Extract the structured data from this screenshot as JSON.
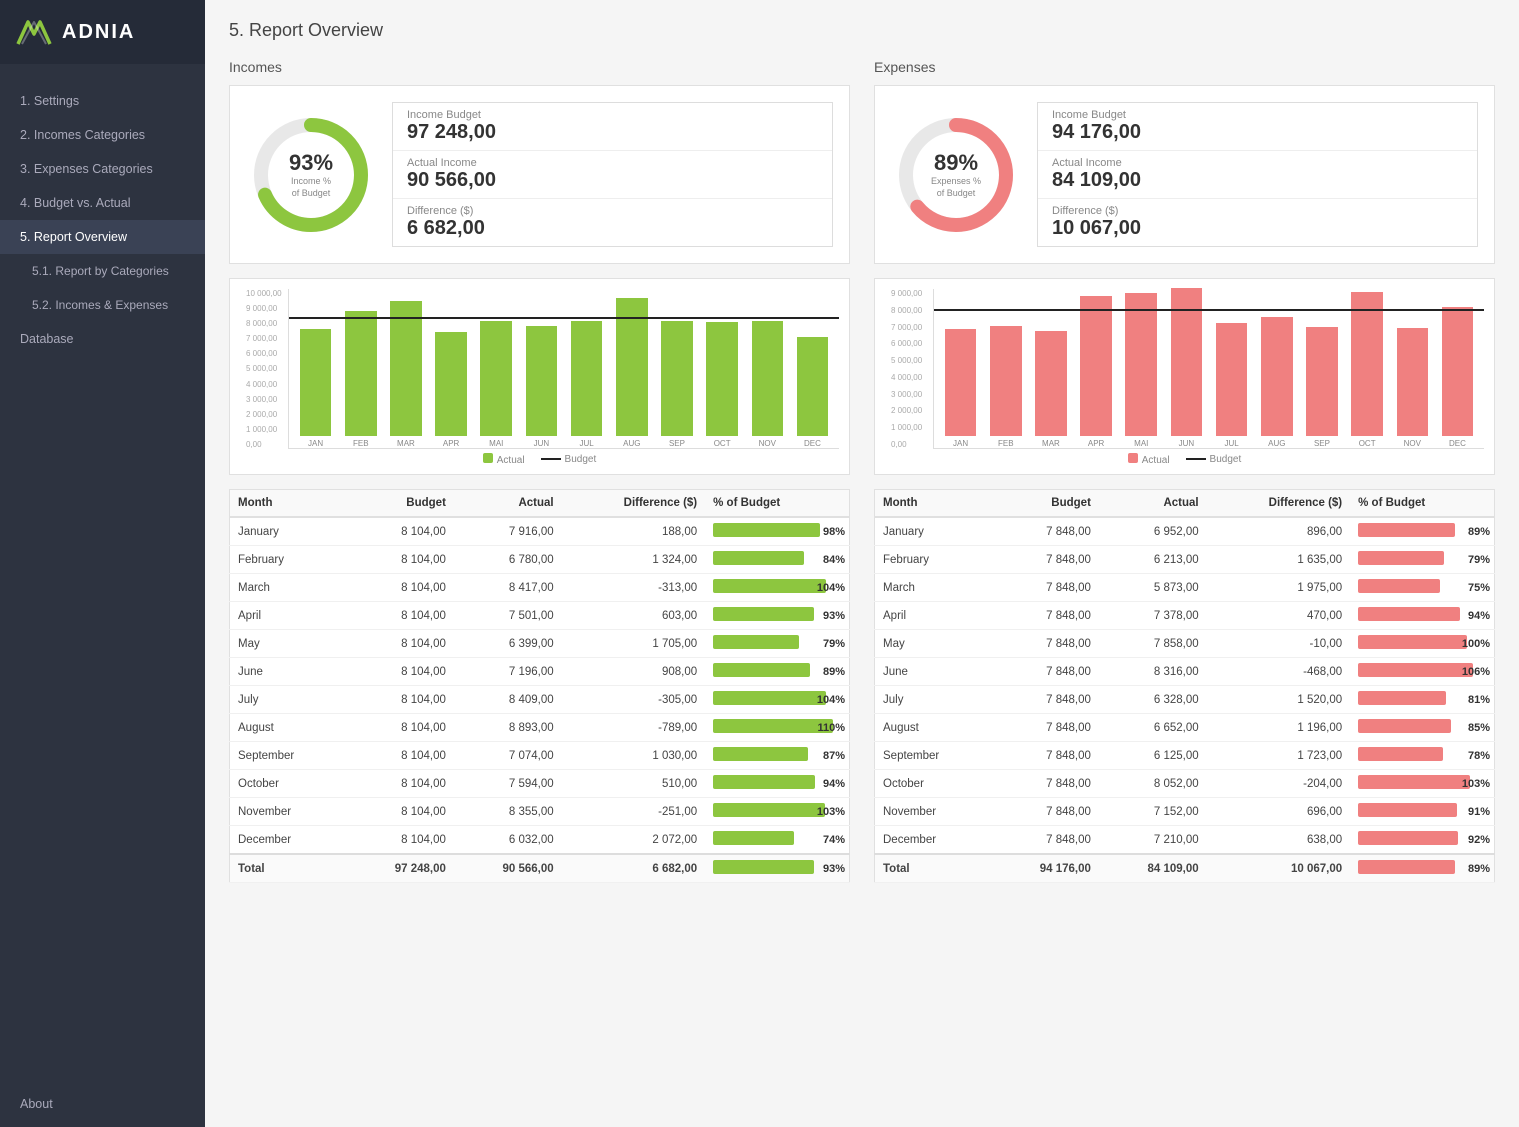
{
  "sidebar": {
    "logo_text": "ADNIA",
    "nav_items": [
      {
        "label": "1. Settings",
        "active": false,
        "sub": false
      },
      {
        "label": "2. Incomes Categories",
        "active": false,
        "sub": false
      },
      {
        "label": "3. Expenses Categories",
        "active": false,
        "sub": false
      },
      {
        "label": "4. Budget vs. Actual",
        "active": false,
        "sub": false
      },
      {
        "label": "5. Report Overview",
        "active": true,
        "sub": false
      },
      {
        "label": "5.1. Report by Categories",
        "active": false,
        "sub": true
      },
      {
        "label": "5.2. Incomes & Expenses",
        "active": false,
        "sub": true
      },
      {
        "label": "Database",
        "active": false,
        "sub": false
      }
    ],
    "footer_label": "About"
  },
  "page_title": "5. Report Overview",
  "incomes": {
    "section_title": "Incomes",
    "gauge_pct": "93%",
    "gauge_label1": "Income %",
    "gauge_label2": "of Budget",
    "gauge_color": "#8dc63f",
    "stats": [
      {
        "label": "Income Budget",
        "value": "97 248,00"
      },
      {
        "label": "Actual Income",
        "value": "90 566,00"
      },
      {
        "label": "Difference ($)",
        "value": "6 682,00"
      }
    ],
    "chart_budget_line_pct": 78,
    "bars": [
      {
        "month": "JAN",
        "actual": 6700,
        "budget": 8104,
        "color": "#8dc63f"
      },
      {
        "month": "FEB",
        "actual": 7800,
        "budget": 8104,
        "color": "#8dc63f"
      },
      {
        "month": "MAR",
        "actual": 8417,
        "budget": 8104,
        "color": "#8dc63f"
      },
      {
        "month": "APR",
        "actual": 6500,
        "budget": 8104,
        "color": "#8dc63f"
      },
      {
        "month": "MAI",
        "actual": 7200,
        "budget": 8104,
        "color": "#8dc63f"
      },
      {
        "month": "JUN",
        "actual": 6900,
        "budget": 8104,
        "color": "#8dc63f"
      },
      {
        "month": "JUL",
        "actual": 7200,
        "budget": 8104,
        "color": "#8dc63f"
      },
      {
        "month": "AUG",
        "actual": 8600,
        "budget": 8104,
        "color": "#8dc63f"
      },
      {
        "month": "SEP",
        "actual": 7200,
        "budget": 8104,
        "color": "#8dc63f"
      },
      {
        "month": "OCT",
        "actual": 7100,
        "budget": 8104,
        "color": "#8dc63f"
      },
      {
        "month": "NOV",
        "actual": 7200,
        "budget": 8104,
        "color": "#8dc63f"
      },
      {
        "month": "DEC",
        "actual": 6200,
        "budget": 8104,
        "color": "#8dc63f"
      }
    ],
    "y_labels": [
      "10 000,00",
      "9 000,00",
      "8 000,00",
      "7 000,00",
      "6 000,00",
      "5 000,00",
      "4 000,00",
      "3 000,00",
      "2 000,00",
      "1 000,00",
      "0,00"
    ],
    "chart_max": 10000,
    "table_headers": [
      "Month",
      "Budget",
      "Actual",
      "Difference ($)",
      "% of Budget"
    ],
    "table_rows": [
      {
        "month": "January",
        "budget": "8 104,00",
        "actual": "7 916,00",
        "diff": "188,00",
        "pct": 98
      },
      {
        "month": "February",
        "budget": "8 104,00",
        "actual": "6 780,00",
        "diff": "1 324,00",
        "pct": 84
      },
      {
        "month": "March",
        "budget": "8 104,00",
        "actual": "8 417,00",
        "diff": "-313,00",
        "pct": 104
      },
      {
        "month": "April",
        "budget": "8 104,00",
        "actual": "7 501,00",
        "diff": "603,00",
        "pct": 93
      },
      {
        "month": "May",
        "budget": "8 104,00",
        "actual": "6 399,00",
        "diff": "1 705,00",
        "pct": 79
      },
      {
        "month": "June",
        "budget": "8 104,00",
        "actual": "7 196,00",
        "diff": "908,00",
        "pct": 89
      },
      {
        "month": "July",
        "budget": "8 104,00",
        "actual": "8 409,00",
        "diff": "-305,00",
        "pct": 104
      },
      {
        "month": "August",
        "budget": "8 104,00",
        "actual": "8 893,00",
        "diff": "-789,00",
        "pct": 110
      },
      {
        "month": "September",
        "budget": "8 104,00",
        "actual": "7 074,00",
        "diff": "1 030,00",
        "pct": 87
      },
      {
        "month": "October",
        "budget": "8 104,00",
        "actual": "7 594,00",
        "diff": "510,00",
        "pct": 94
      },
      {
        "month": "November",
        "budget": "8 104,00",
        "actual": "8 355,00",
        "diff": "-251,00",
        "pct": 103
      },
      {
        "month": "December",
        "budget": "8 104,00",
        "actual": "6 032,00",
        "diff": "2 072,00",
        "pct": 74
      }
    ],
    "table_total": {
      "month": "Total",
      "budget": "97 248,00",
      "actual": "90 566,00",
      "diff": "6 682,00",
      "pct": 93
    }
  },
  "expenses": {
    "section_title": "Expenses",
    "gauge_pct": "89%",
    "gauge_label1": "Expenses %",
    "gauge_label2": "of Budget",
    "gauge_color": "#f08080",
    "stats": [
      {
        "label": "Income Budget",
        "value": "94 176,00"
      },
      {
        "label": "Actual Income",
        "value": "84 109,00"
      },
      {
        "label": "Difference ($)",
        "value": "10 067,00"
      }
    ],
    "chart_max": 9000,
    "bars": [
      {
        "month": "JAN",
        "actual": 6000,
        "budget": 7848,
        "color": "#f08080"
      },
      {
        "month": "FEB",
        "actual": 6200,
        "budget": 7848,
        "color": "#f08080"
      },
      {
        "month": "MAR",
        "actual": 5900,
        "budget": 7848,
        "color": "#f08080"
      },
      {
        "month": "APR",
        "actual": 7900,
        "budget": 7848,
        "color": "#f08080"
      },
      {
        "month": "MAI",
        "actual": 8050,
        "budget": 7848,
        "color": "#f08080"
      },
      {
        "month": "JUN",
        "actual": 8350,
        "budget": 7848,
        "color": "#f08080"
      },
      {
        "month": "JUL",
        "actual": 6350,
        "budget": 7848,
        "color": "#f08080"
      },
      {
        "month": "AUG",
        "actual": 6700,
        "budget": 7848,
        "color": "#f08080"
      },
      {
        "month": "SEP",
        "actual": 6150,
        "budget": 7848,
        "color": "#f08080"
      },
      {
        "month": "OCT",
        "actual": 8100,
        "budget": 7848,
        "color": "#f08080"
      },
      {
        "month": "NOV",
        "actual": 6100,
        "budget": 7848,
        "color": "#f08080"
      },
      {
        "month": "DEC",
        "actual": 7250,
        "budget": 7848,
        "color": "#f08080"
      }
    ],
    "y_labels": [
      "9 000,00",
      "8 000,00",
      "7 000,00",
      "6 000,00",
      "5 000,00",
      "4 000,00",
      "3 000,00",
      "2 000,00",
      "1 000,00",
      "0,00"
    ],
    "table_headers": [
      "Month",
      "Budget",
      "Actual",
      "Difference ($)",
      "% of Budget"
    ],
    "table_rows": [
      {
        "month": "January",
        "budget": "7 848,00",
        "actual": "6 952,00",
        "diff": "896,00",
        "pct": 89
      },
      {
        "month": "February",
        "budget": "7 848,00",
        "actual": "6 213,00",
        "diff": "1 635,00",
        "pct": 79
      },
      {
        "month": "March",
        "budget": "7 848,00",
        "actual": "5 873,00",
        "diff": "1 975,00",
        "pct": 75
      },
      {
        "month": "April",
        "budget": "7 848,00",
        "actual": "7 378,00",
        "diff": "470,00",
        "pct": 94
      },
      {
        "month": "May",
        "budget": "7 848,00",
        "actual": "7 858,00",
        "diff": "-10,00",
        "pct": 100
      },
      {
        "month": "June",
        "budget": "7 848,00",
        "actual": "8 316,00",
        "diff": "-468,00",
        "pct": 106
      },
      {
        "month": "July",
        "budget": "7 848,00",
        "actual": "6 328,00",
        "diff": "1 520,00",
        "pct": 81
      },
      {
        "month": "August",
        "budget": "7 848,00",
        "actual": "6 652,00",
        "diff": "1 196,00",
        "pct": 85
      },
      {
        "month": "September",
        "budget": "7 848,00",
        "actual": "6 125,00",
        "diff": "1 723,00",
        "pct": 78
      },
      {
        "month": "October",
        "budget": "7 848,00",
        "actual": "8 052,00",
        "diff": "-204,00",
        "pct": 103
      },
      {
        "month": "November",
        "budget": "7 848,00",
        "actual": "7 152,00",
        "diff": "696,00",
        "pct": 91
      },
      {
        "month": "December",
        "budget": "7 848,00",
        "actual": "7 210,00",
        "diff": "638,00",
        "pct": 92
      }
    ],
    "table_total": {
      "month": "Total",
      "budget": "94 176,00",
      "actual": "84 109,00",
      "diff": "10 067,00",
      "pct": 89
    }
  }
}
